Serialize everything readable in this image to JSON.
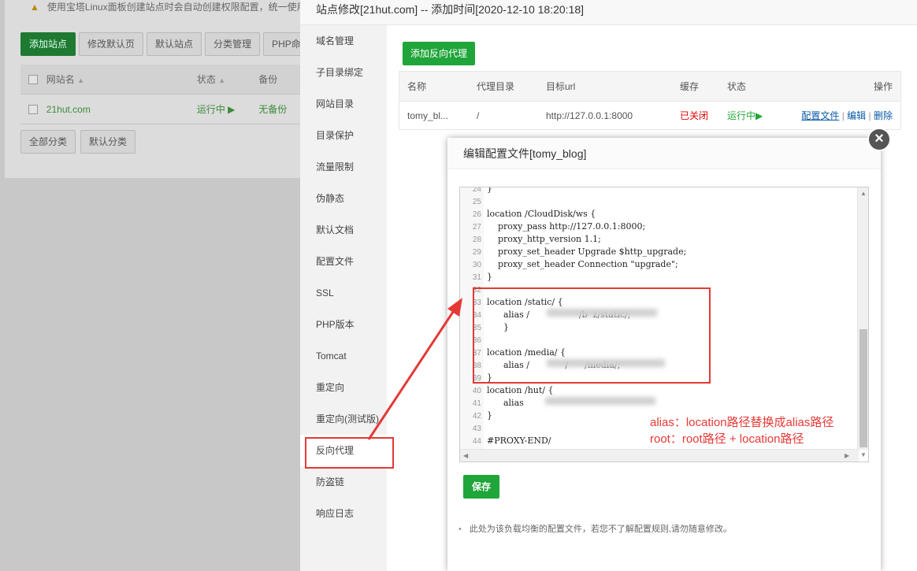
{
  "background": {
    "notice": "使用宝塔Linux面板创建站点时会自动创建权限配置，统一使用",
    "toolbar": [
      "添加站点",
      "修改默认页",
      "默认站点",
      "分类管理",
      "PHP命令"
    ],
    "table_head": {
      "name": "网站名",
      "status": "状态",
      "backup": "备份"
    },
    "row": {
      "name": "21hut.com",
      "status": "运行中 ▶",
      "backup": "无备份"
    },
    "bottom_buttons": [
      "全部分类",
      "默认分类"
    ]
  },
  "site_modal": {
    "title": "站点修改[21hut.com] -- 添加时间[2020-12-10 18:20:18]",
    "menu": [
      "域名管理",
      "子目录绑定",
      "网站目录",
      "目录保护",
      "流量限制",
      "伪静态",
      "默认文档",
      "配置文件",
      "SSL",
      "PHP版本",
      "Tomcat",
      "重定向",
      "重定向(测试版)",
      "反向代理",
      "防盗链",
      "响应日志"
    ],
    "add_proxy_label": "添加反向代理",
    "table_head": [
      "名称",
      "代理目录",
      "目标url",
      "缓存",
      "状态",
      "操作"
    ],
    "row": {
      "name": "tomy_bl...",
      "dir": "/",
      "url": "http://127.0.0.1:8000",
      "cache": "已关闭",
      "status": "运行中▶",
      "op_config": "配置文件",
      "op_edit": "编辑",
      "op_delete": "删除",
      "sep": "|"
    }
  },
  "config_modal": {
    "title": "编辑配置文件[tomy_blog]",
    "close_symbol": "×",
    "lines": [
      {
        "n": "24",
        "t": "}"
      },
      {
        "n": "25",
        "t": ""
      },
      {
        "n": "26",
        "t": "location /CloudDisk/ws {"
      },
      {
        "n": "27",
        "t": "    proxy_pass http://127.0.0.1:8000;"
      },
      {
        "n": "28",
        "t": "    proxy_http_version 1.1;"
      },
      {
        "n": "29",
        "t": "    proxy_set_header Upgrade $http_upgrade;"
      },
      {
        "n": "30",
        "t": "    proxy_set_header Connection \"upgrade\";"
      },
      {
        "n": "31",
        "t": "}"
      },
      {
        "n": "32",
        "t": ""
      },
      {
        "n": "33",
        "t": "location /static/ {"
      },
      {
        "n": "34",
        "t": "      alias /                  /b  z/static/;"
      },
      {
        "n": "35",
        "t": "      }"
      },
      {
        "n": "36",
        "t": ""
      },
      {
        "n": "37",
        "t": "location /media/ {"
      },
      {
        "n": "38",
        "t": "      alias /             /      /media/;"
      },
      {
        "n": "39",
        "t": "}"
      },
      {
        "n": "40",
        "t": "location /hut/ {"
      },
      {
        "n": "41",
        "t": "      alias "
      },
      {
        "n": "42",
        "t": "}"
      },
      {
        "n": "43",
        "t": ""
      },
      {
        "n": "44",
        "t": "#PROXY-END/"
      }
    ],
    "save_label": "保存",
    "note": "此处为该负载均衡的配置文件，若您不了解配置规则,请勿随意修改。",
    "note_bullet": "•"
  },
  "annotations": {
    "line1": "alias：location路径替换成alias路径",
    "line2": "root：root路径 + location路径",
    "color": "#e53935"
  }
}
